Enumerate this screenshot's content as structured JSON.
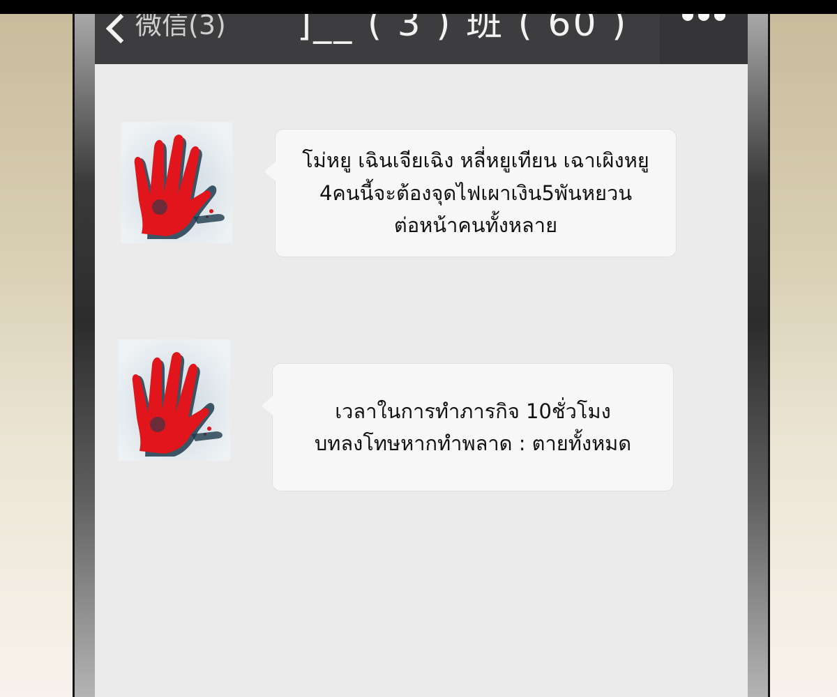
{
  "nav": {
    "back_label": "微信(3)",
    "title": "]__ ( 3 ) 班 ( 60 )",
    "more_icon": "more-dots-icon"
  },
  "messages": [
    {
      "avatar_icon": "bloody-hand-icon",
      "lines": [
        "โม่หยู เฉินเจียเฉิง หลี่หยูเทียน เฉาเผิงหยู",
        "4คนนี้จะต้องจุดไฟเผาเงิน5พันหยวน",
        "ต่อหน้าคนทั้งหลาย"
      ]
    },
    {
      "avatar_icon": "bloody-hand-icon",
      "lines": [
        "เวลาในการทำภารกิจ 10ชั่วโมง",
        "บทลงโทษหากทำพลาด : ตายทั้งหมด"
      ]
    }
  ],
  "colors": {
    "nav_bg": "#3d3d40",
    "screen_bg": "#ebebeb",
    "bubble_bg": "#f7f7f7",
    "hand_red": "#e0161c",
    "hand_shadow": "#1d3b4d"
  }
}
